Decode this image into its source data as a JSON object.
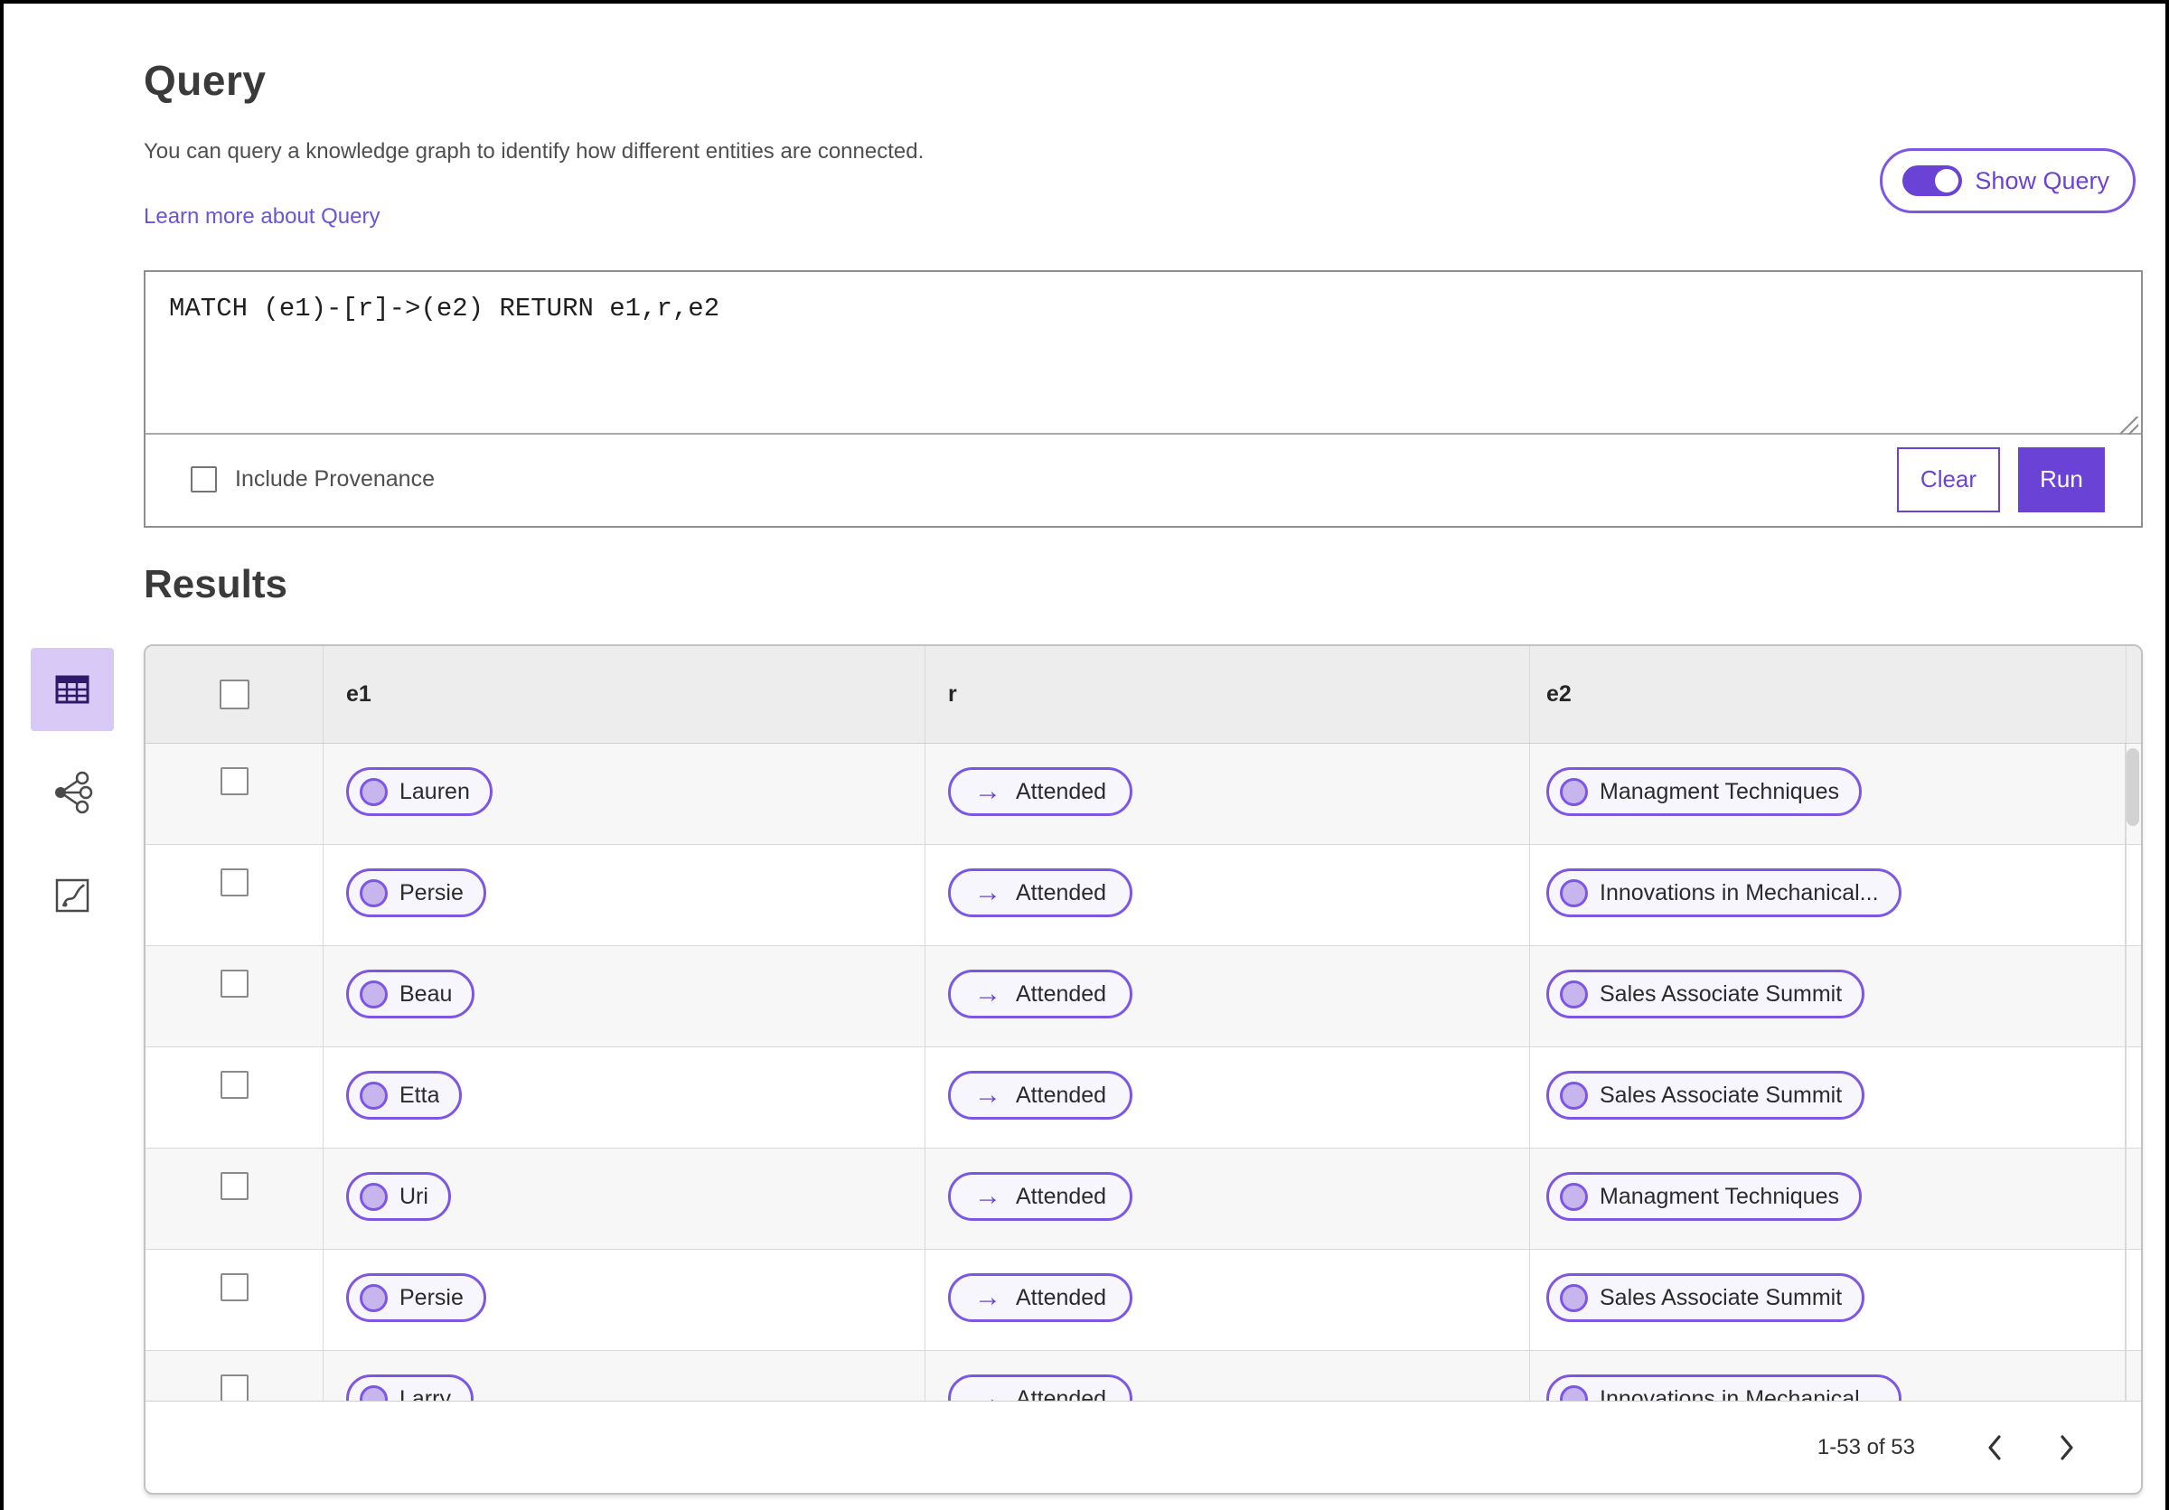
{
  "header": {
    "title": "Query",
    "description": "You can query a knowledge graph to identify how different entities are connected.",
    "learn_more_link": "Learn more about Query",
    "show_query_toggle": {
      "label": "Show Query",
      "state": "on"
    }
  },
  "query_editor": {
    "query_text": "MATCH (e1)-[r]->(e2) RETURN e1,r,e2",
    "include_provenance": {
      "label": "Include Provenance",
      "checked": false
    },
    "clear_button": "Clear",
    "run_button": "Run"
  },
  "results": {
    "title": "Results",
    "view_switcher": [
      {
        "name": "table-view",
        "selected": true
      },
      {
        "name": "graph-view",
        "selected": false
      },
      {
        "name": "chart-view",
        "selected": false
      }
    ],
    "table": {
      "columns": [
        "e1",
        "r",
        "e2"
      ],
      "relation_arrow": "→",
      "rows": [
        {
          "e1": "Lauren",
          "r": "Attended",
          "e2": "Managment Techniques"
        },
        {
          "e1": "Persie",
          "r": "Attended",
          "e2": "Innovations in Mechanical..."
        },
        {
          "e1": "Beau",
          "r": "Attended",
          "e2": "Sales Associate Summit"
        },
        {
          "e1": "Etta",
          "r": "Attended",
          "e2": "Sales Associate Summit"
        },
        {
          "e1": "Uri",
          "r": "Attended",
          "e2": "Managment Techniques"
        },
        {
          "e1": "Persie",
          "r": "Attended",
          "e2": "Sales Associate Summit"
        },
        {
          "e1": "Larry",
          "r": "Attended",
          "e2": "Innovations in Mechanical..."
        }
      ]
    },
    "pagination": {
      "range_label": "1-53 of 53"
    }
  },
  "colors": {
    "primary_purple": "#6b42d6",
    "link_purple": "#6b54d8",
    "pill_border": "#7d57e3",
    "pill_background": "#f8f6fd",
    "node_circle_fill": "#c7b5ee",
    "selected_view_background": "#d9c9f6",
    "table_header_background": "#ededed",
    "row_alternate_background": "#f7f7f7"
  }
}
